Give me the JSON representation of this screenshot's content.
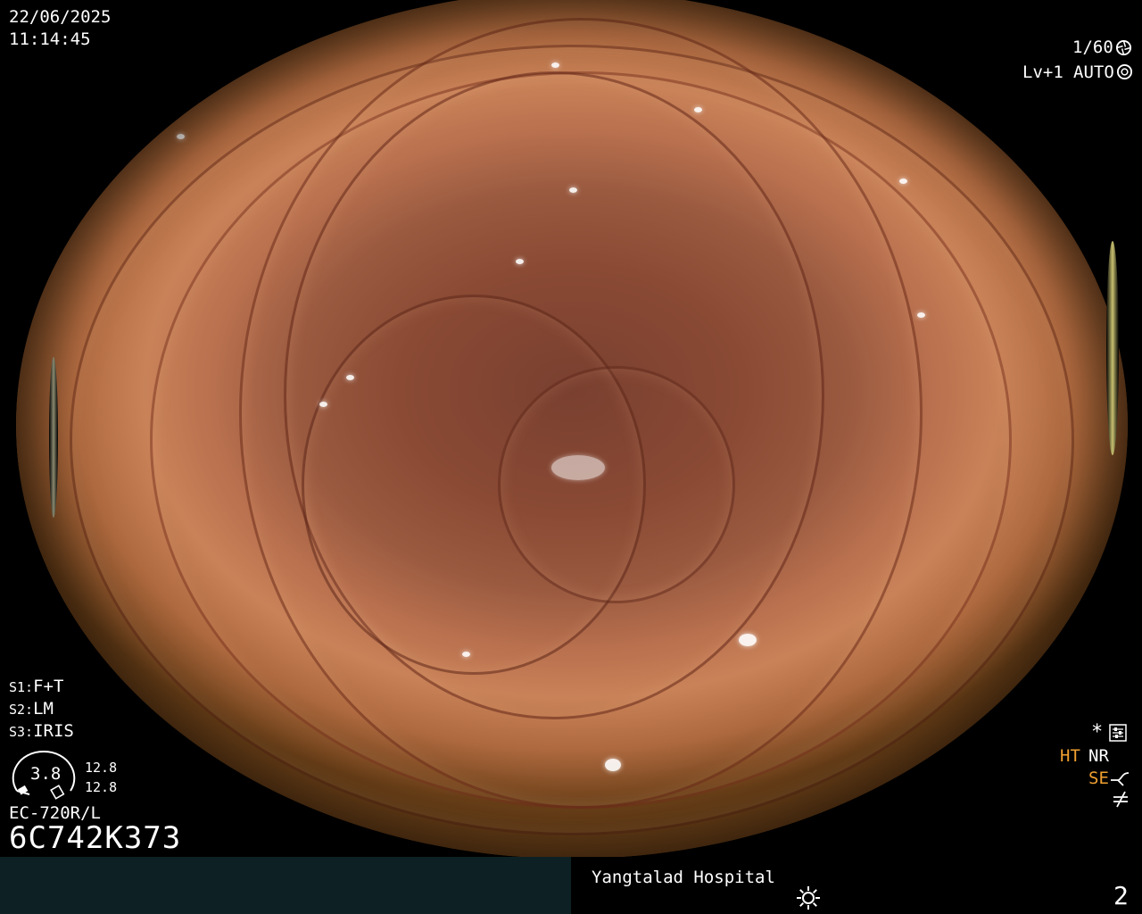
{
  "overlay": {
    "date": "22/06/2025",
    "time": "11:14:45",
    "shutter": "1/60",
    "shutter_icon": "aperture-icon",
    "level": "Lv+1",
    "mode": "AUTO",
    "mode_icon": "iris-icon",
    "settings": [
      {
        "key": "S1:",
        "value": "F+T"
      },
      {
        "key": "S2:",
        "value": "LM"
      },
      {
        "key": "S3:",
        "value": "IRIS"
      }
    ],
    "gauge_value": "3.8",
    "gauge_top": "12.8",
    "gauge_bottom": "12.8",
    "scope_model": "EC-720R/L",
    "serial": "6C742K373",
    "right_indicators": {
      "star": "*",
      "star_icon": "settings-sliders-icon",
      "ht": "HT",
      "nr": "NR",
      "se": "SE",
      "se_icon": "curve-enhance-icon",
      "last_icon": "not-equal-icon"
    }
  },
  "footer": {
    "hospital": "Yangtalad Hospital",
    "light_icon": "sun-icon",
    "page_number": "2"
  },
  "colors": {
    "orange_text": "#f0a030",
    "footer_left_bg": "#0d2124",
    "mucosa": "#b8704e"
  }
}
